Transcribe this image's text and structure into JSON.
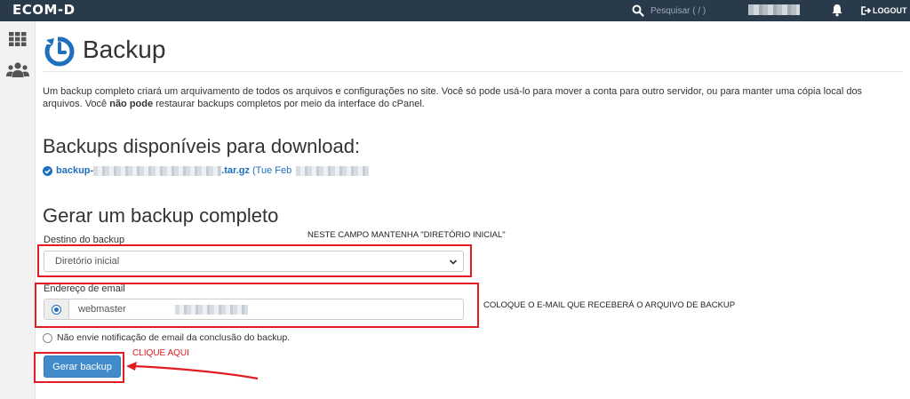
{
  "topbar": {
    "brand": "ECOM-D",
    "search_placeholder": "Pesquisar ( / )",
    "logout_label": "LOGOUT"
  },
  "sidebar": {
    "items": [
      {
        "icon": "grid-icon"
      },
      {
        "icon": "users-icon"
      }
    ]
  },
  "page": {
    "title": "Backup",
    "description_pre": "Um backup completo criará um arquivamento de todos os arquivos e configurações no site. Você só pode usá-lo para mover a conta para outro servidor, ou para manter uma cópia local dos arquivos. Você ",
    "description_bold": "não pode",
    "description_post": " restaurar backups completos por meio da interface do cPanel."
  },
  "available": {
    "heading": "Backups disponíveis para download:",
    "backup_prefix": "backup-",
    "backup_suffix": ".tar.gz",
    "date_prefix": "(Tue Feb"
  },
  "generate": {
    "heading": "Gerar um backup completo",
    "destination_label": "Destino do backup",
    "destination_value": "Diretório inicial",
    "email_label": "Endereço de email",
    "email_value": "webmaster",
    "no_email_label": "Não envie notificação de email da conclusão do backup.",
    "button_label": "Gerar backup"
  },
  "annotations": {
    "destination_note": "NESTE CAMPO MANTENHA \"DIRETÓRIO INICIAL\"",
    "email_note": "COLOQUE O E-MAIL QUE RECEBERÁ O ARQUIVO DE BACKUP",
    "click_note": "CLIQUE AQUI",
    "color": "#e31b23"
  },
  "colors": {
    "topbar": "#293a4a",
    "accent": "#1f6fbf",
    "button": "#428bca"
  }
}
